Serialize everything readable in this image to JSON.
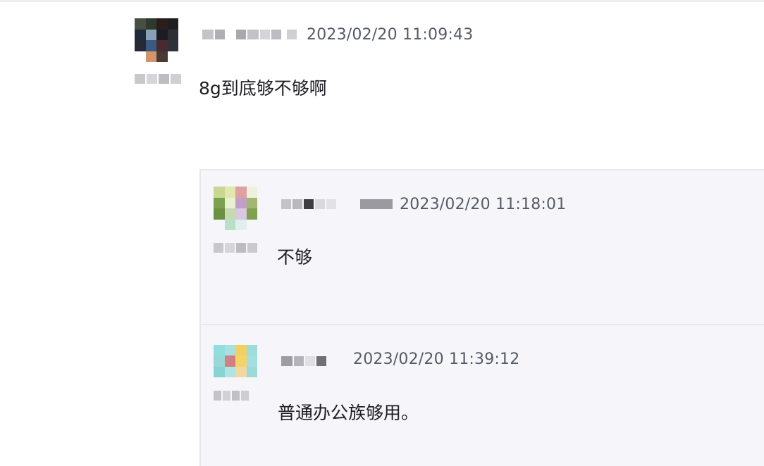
{
  "comment": {
    "timestamp": "2023/02/20 11:09:43",
    "text": "8g到底够不够啊",
    "avatar_icon": "user-avatar-blurred"
  },
  "replies": [
    {
      "timestamp": "2023/02/20 11:18:01",
      "text": "不够",
      "avatar_icon": "user-avatar-blurred"
    },
    {
      "timestamp": "2023/02/20 11:39:12",
      "text": "普通办公族够用。",
      "avatar_icon": "user-avatar-blurred"
    }
  ],
  "colors": {
    "background": "#ffffff",
    "reply_background": "#f6f6fa",
    "timestamp": "#555a66",
    "text": "#1e1e22"
  }
}
